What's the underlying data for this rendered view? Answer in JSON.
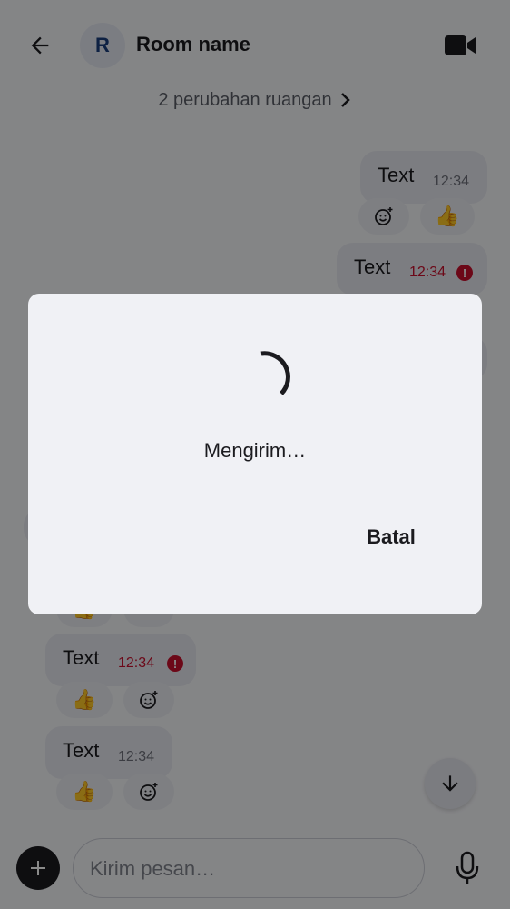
{
  "header": {
    "back_icon": "arrow-left-icon",
    "avatar_initial": "R",
    "room_name": "Room name",
    "video_icon": "video-camera-icon"
  },
  "timeline": {
    "room_changes_label": "2 perubahan ruangan",
    "messages": [
      {
        "side": "out",
        "text": "Text",
        "time": "12:34",
        "error": false,
        "reactions": [
          "😊+",
          "👍"
        ]
      },
      {
        "side": "out",
        "text": "Text",
        "time": "12:34",
        "error": true
      },
      {
        "side": "in",
        "text": "Text",
        "time": "12:34",
        "error": true,
        "reactions": [
          "👍",
          "😊+"
        ]
      },
      {
        "side": "in",
        "text": "Text",
        "time": "12:34",
        "error": false,
        "reactions": [
          "👍",
          "😊+"
        ]
      }
    ],
    "error_mark": "!"
  },
  "composer": {
    "add_icon": "plus-icon",
    "placeholder": "Kirim pesan…",
    "mic_icon": "microphone-icon",
    "scroll_down_icon": "arrow-down-icon"
  },
  "dialog": {
    "message": "Mengirim…",
    "cancel_label": "Batal"
  },
  "colors": {
    "accent": "#1a3d7c",
    "error": "#c8102e",
    "scrim": "rgba(0,0,0,0.46)"
  }
}
